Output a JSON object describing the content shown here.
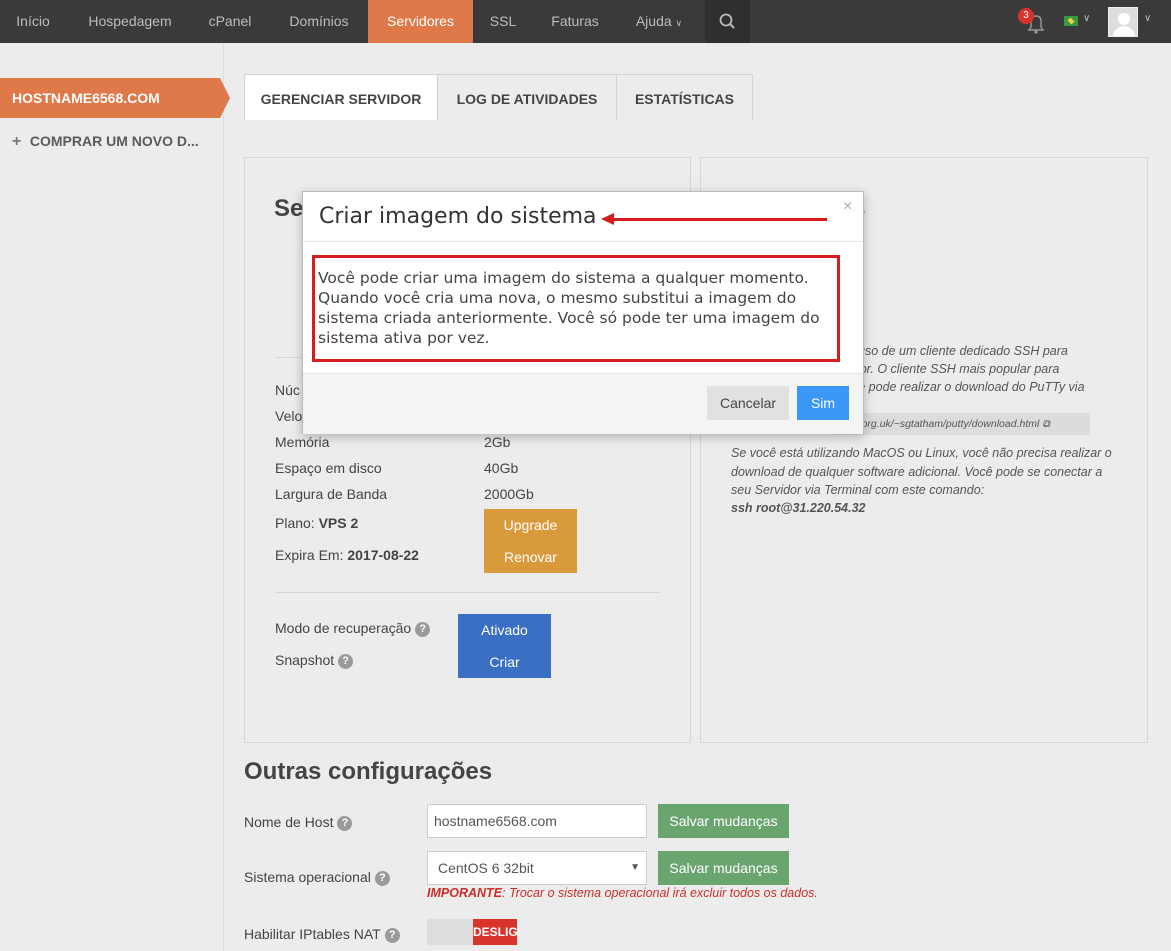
{
  "nav": {
    "items": [
      "Início",
      "Hospedagem",
      "cPanel",
      "Domínios",
      "Servidores",
      "SSL",
      "Faturas",
      "Ajuda"
    ],
    "active": "Servidores",
    "notification_count": "3"
  },
  "sidebar": {
    "hostname": "HOSTNAME6568.COM",
    "buy_new": "COMPRAR UM NOVO D..."
  },
  "tabs": [
    "GERENCIAR SERVIDOR",
    "LOG DE ATIVIDADES",
    "ESTATÍSTICAS"
  ],
  "server_panel": {
    "title_partial": "Se",
    "specs": [
      {
        "label": "Núc",
        "value": ""
      },
      {
        "label": "Velo",
        "value": ""
      },
      {
        "label": "Memória",
        "value": "2Gb"
      },
      {
        "label": "Espaço em disco",
        "value": "40Gb"
      },
      {
        "label": "Largura de Banda",
        "value": "2000Gb"
      }
    ],
    "plan_label": "Plano:",
    "plan_value": "VPS 2",
    "upgrade_button": "Upgrade",
    "expires_label": "Expira Em:",
    "expires_value": "2017-08-22",
    "renew_button": "Renovar",
    "recovery_label": "Modo de recuperação",
    "recovery_button": "Ativado",
    "snapshot_label": "Snapshot",
    "snapshot_button": "Criar"
  },
  "ssh_panel": {
    "title_partial": "s",
    "text1_lines": [
      "uso de um cliente dedicado SSH para",
      "idor. O cliente SSH mais popular para",
      "cê pode realizar o download do PuTTy via"
    ],
    "link": "nd.org.uk/~sgtatham/putty/download.html",
    "text2_lines": [
      "Se você está utilizando MacOS ou Linux, você não precisa realizar o",
      "download de qualquer software adicional. Você pode se conectar a",
      "seu Servidor via Terminal com este comando:"
    ],
    "command": "ssh root@31.220.54.32"
  },
  "other_settings": {
    "title": "Outras configurações",
    "hostname_label": "Nome de Host",
    "hostname_value": "hostname6568.com",
    "save_button": "Salvar mudanças",
    "os_label": "Sistema operacional",
    "os_value": "CentOS 6 32bit",
    "warning_bold": "IMPORANTE",
    "warning_text": ": Trocar o sistema operacional irá excluir todos os dados.",
    "iptables_label": "Habilitar IPtables NAT",
    "toggle_off": "DESLIG"
  },
  "modal": {
    "title": "Criar imagem do sistema",
    "body": "Você pode criar uma imagem do sistema a qualquer momento. Quando você cria uma nova, o mesmo substitui a imagem do sistema criada anteriormente. Você só pode ter uma imagem do sistema ativa por vez.",
    "cancel": "Cancelar",
    "confirm": "Sim",
    "close_glyph": "×"
  },
  "colors": {
    "accent": "#e0794a",
    "annotation_red": "#d61c1c",
    "primary_blue": "#3b97f5"
  }
}
